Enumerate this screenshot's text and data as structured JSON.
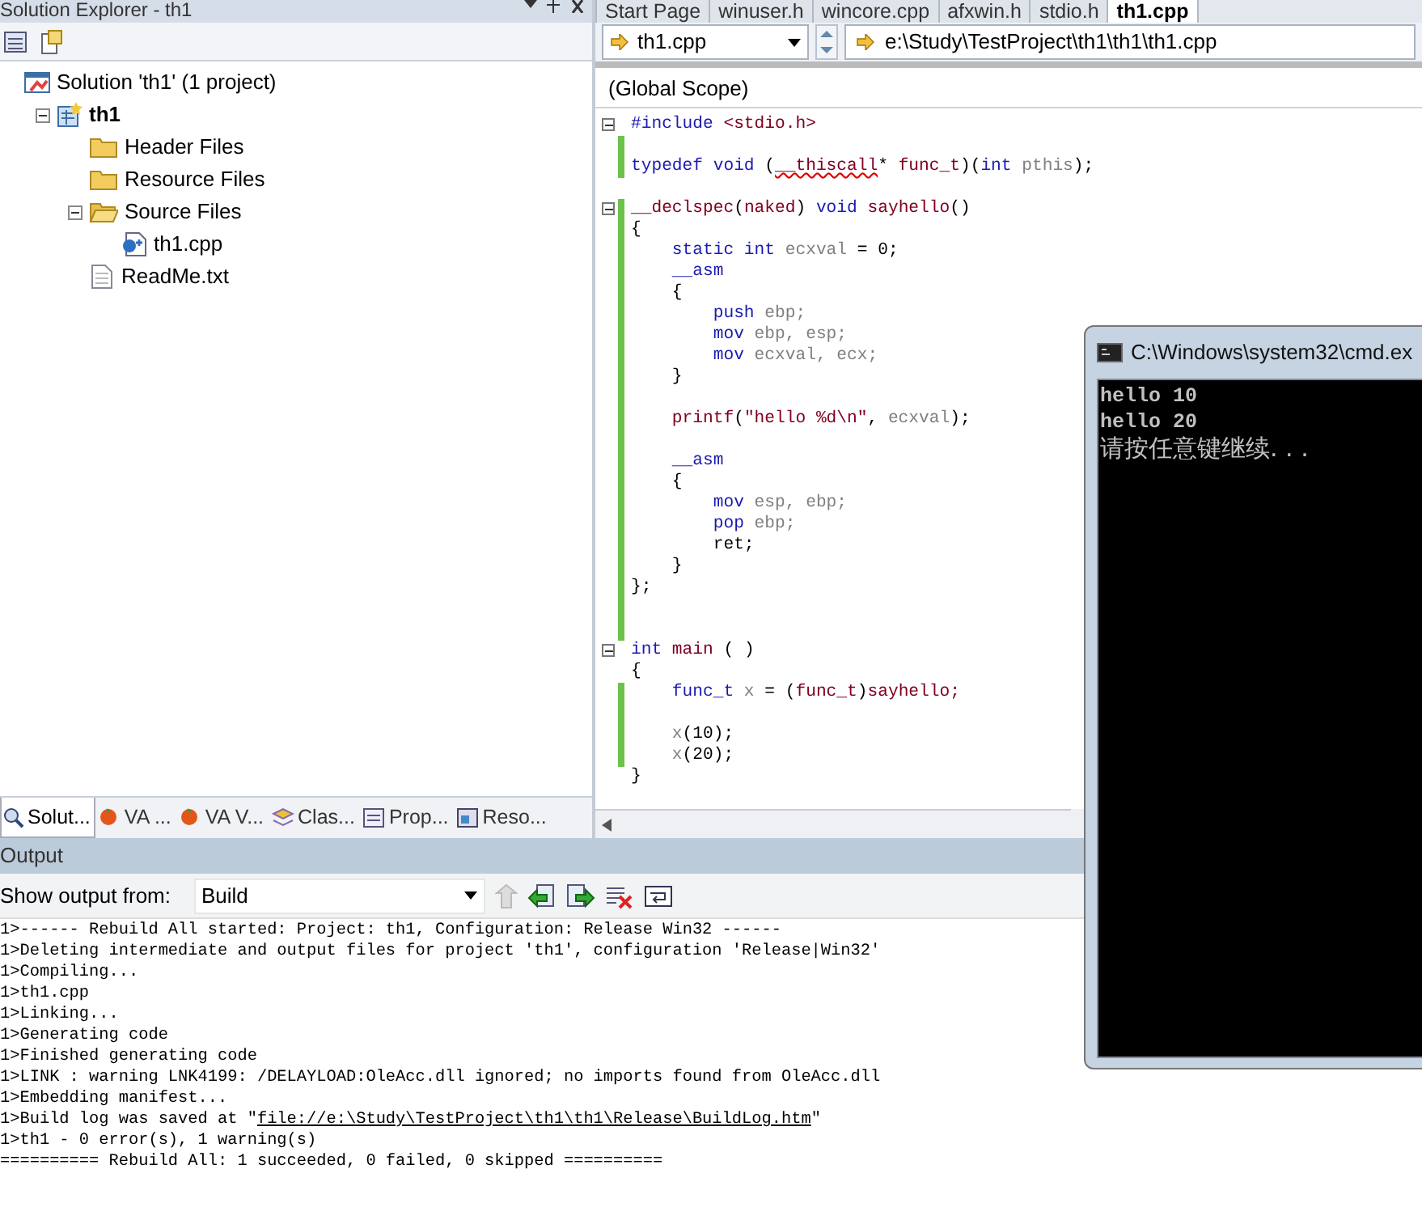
{
  "solution_explorer": {
    "title": "Solution Explorer - th1",
    "tree": [
      {
        "label": "Solution 'th1' (1 project)",
        "kind": "solution",
        "children": [
          {
            "label": "th1",
            "kind": "project",
            "expanded": true,
            "children": [
              {
                "label": "Header Files",
                "kind": "folder"
              },
              {
                "label": "Resource Files",
                "kind": "folder"
              },
              {
                "label": "Source Files",
                "kind": "folder-open",
                "expanded": true,
                "children": [
                  {
                    "label": "th1.cpp",
                    "kind": "cpp"
                  }
                ]
              },
              {
                "label": "ReadMe.txt",
                "kind": "text"
              }
            ]
          }
        ]
      }
    ],
    "tabs": [
      {
        "label": "Solut...",
        "selected": true
      },
      {
        "label": "VA ...",
        "selected": false
      },
      {
        "label": "VA V...",
        "selected": false
      },
      {
        "label": "Clas...",
        "selected": false
      },
      {
        "label": "Prop...",
        "selected": false
      },
      {
        "label": "Reso...",
        "selected": false
      }
    ]
  },
  "editor": {
    "tabs": [
      {
        "label": "Start Page",
        "selected": false
      },
      {
        "label": "winuser.h",
        "selected": false
      },
      {
        "label": "wincore.cpp",
        "selected": false
      },
      {
        "label": "afxwin.h",
        "selected": false
      },
      {
        "label": "stdio.h",
        "selected": false
      },
      {
        "label": "th1.cpp",
        "selected": true
      }
    ],
    "file_dropdown": "th1.cpp",
    "path": "e:\\Study\\TestProject\\th1\\th1\\th1.cpp",
    "scope": "(Global Scope)",
    "lines": [
      {
        "kind": "code",
        "fold": true,
        "changed": false,
        "tokens": [
          {
            "text": "#include",
            "kind": "kw"
          },
          {
            "text": " <stdio.h>",
            "kind": "fn"
          }
        ]
      },
      {
        "kind": "blank",
        "changed": true
      },
      {
        "kind": "code",
        "fold": false,
        "changed": true,
        "tokens": [
          {
            "text": "typedef void",
            "kind": "kw"
          },
          {
            "text": " (",
            "kind": "p"
          },
          {
            "text": "__thiscall",
            "kind": "err"
          },
          {
            "text": "* ",
            "kind": "p"
          },
          {
            "text": "func_t",
            "kind": "fn"
          },
          {
            "text": ")(",
            "kind": "p"
          },
          {
            "text": "int",
            "kind": "kw"
          },
          {
            "text": " pthis",
            "kind": "id"
          },
          {
            "text": ");",
            "kind": "p"
          }
        ]
      },
      {
        "kind": "blank",
        "changed": false
      },
      {
        "kind": "code",
        "fold": true,
        "changed": true,
        "tokens": [
          {
            "text": "__declspec",
            "kind": "fn"
          },
          {
            "text": "(",
            "kind": "p"
          },
          {
            "text": "naked",
            "kind": "fn"
          },
          {
            "text": ") ",
            "kind": "p"
          },
          {
            "text": "void",
            "kind": "kw"
          },
          {
            "text": " sayhello",
            "kind": "fn"
          },
          {
            "text": "()",
            "kind": "p"
          }
        ]
      },
      {
        "kind": "code",
        "fold": false,
        "changed": true,
        "tokens": [
          {
            "text": "{",
            "kind": "p"
          }
        ]
      },
      {
        "kind": "code",
        "fold": false,
        "changed": true,
        "tokens": [
          {
            "text": "    static int",
            "kind": "kw"
          },
          {
            "text": " ecxval",
            "kind": "id"
          },
          {
            "text": " = 0;",
            "kind": "p"
          }
        ]
      },
      {
        "kind": "code",
        "fold": false,
        "changed": true,
        "tokens": [
          {
            "text": "    __asm",
            "kind": "kw"
          }
        ]
      },
      {
        "kind": "code",
        "fold": false,
        "changed": true,
        "tokens": [
          {
            "text": "    {",
            "kind": "p"
          }
        ]
      },
      {
        "kind": "code",
        "fold": false,
        "changed": true,
        "tokens": [
          {
            "text": "        push",
            "kind": "kw"
          },
          {
            "text": " ebp;",
            "kind": "id"
          }
        ]
      },
      {
        "kind": "code",
        "fold": false,
        "changed": true,
        "tokens": [
          {
            "text": "        mov",
            "kind": "kw"
          },
          {
            "text": " ebp, esp;",
            "kind": "id"
          }
        ]
      },
      {
        "kind": "code",
        "fold": false,
        "changed": true,
        "tokens": [
          {
            "text": "        mov",
            "kind": "kw"
          },
          {
            "text": " ecxval, ecx;",
            "kind": "id"
          }
        ]
      },
      {
        "kind": "code",
        "fold": false,
        "changed": true,
        "tokens": [
          {
            "text": "    }",
            "kind": "p"
          }
        ]
      },
      {
        "kind": "blank",
        "changed": true
      },
      {
        "kind": "code",
        "fold": false,
        "changed": true,
        "tokens": [
          {
            "text": "    printf",
            "kind": "fn"
          },
          {
            "text": "(",
            "kind": "p"
          },
          {
            "text": "\"hello %d\\n\"",
            "kind": "fn"
          },
          {
            "text": ", ",
            "kind": "p"
          },
          {
            "text": "ecxval",
            "kind": "id"
          },
          {
            "text": ");",
            "kind": "p"
          }
        ]
      },
      {
        "kind": "blank",
        "changed": true
      },
      {
        "kind": "code",
        "fold": false,
        "changed": true,
        "tokens": [
          {
            "text": "    __asm",
            "kind": "kw"
          }
        ]
      },
      {
        "kind": "code",
        "fold": false,
        "changed": true,
        "tokens": [
          {
            "text": "    {",
            "kind": "p"
          }
        ]
      },
      {
        "kind": "code",
        "fold": false,
        "changed": true,
        "tokens": [
          {
            "text": "        mov",
            "kind": "kw"
          },
          {
            "text": " esp, ebp;",
            "kind": "id"
          }
        ]
      },
      {
        "kind": "code",
        "fold": false,
        "changed": true,
        "tokens": [
          {
            "text": "        pop",
            "kind": "kw"
          },
          {
            "text": " ebp;",
            "kind": "id"
          }
        ]
      },
      {
        "kind": "code",
        "fold": false,
        "changed": true,
        "tokens": [
          {
            "text": "        ret;",
            "kind": "p"
          }
        ]
      },
      {
        "kind": "code",
        "fold": false,
        "changed": true,
        "tokens": [
          {
            "text": "    }",
            "kind": "p"
          }
        ]
      },
      {
        "kind": "code",
        "fold": false,
        "changed": true,
        "tokens": [
          {
            "text": "};",
            "kind": "p"
          }
        ]
      },
      {
        "kind": "blank",
        "changed": true
      },
      {
        "kind": "blank",
        "changed": true
      },
      {
        "kind": "code",
        "fold": true,
        "changed": false,
        "tokens": [
          {
            "text": "int",
            "kind": "kw"
          },
          {
            "text": " main",
            "kind": "fn"
          },
          {
            "text": " ( )",
            "kind": "p"
          }
        ]
      },
      {
        "kind": "code",
        "fold": false,
        "changed": false,
        "tokens": [
          {
            "text": "{",
            "kind": "p"
          }
        ]
      },
      {
        "kind": "code",
        "fold": false,
        "changed": true,
        "tokens": [
          {
            "text": "    func_t",
            "kind": "kw"
          },
          {
            "text": " x",
            "kind": "id"
          },
          {
            "text": " = (",
            "kind": "p"
          },
          {
            "text": "func_t",
            "kind": "fn"
          },
          {
            "text": ")",
            "kind": "p"
          },
          {
            "text": "sayhello;",
            "kind": "fn"
          }
        ]
      },
      {
        "kind": "blank",
        "changed": true
      },
      {
        "kind": "code",
        "fold": false,
        "changed": true,
        "tokens": [
          {
            "text": "    x",
            "kind": "id"
          },
          {
            "text": "(10);",
            "kind": "p"
          }
        ]
      },
      {
        "kind": "code",
        "fold": false,
        "changed": true,
        "tokens": [
          {
            "text": "    x",
            "kind": "id"
          },
          {
            "text": "(20);",
            "kind": "p"
          }
        ]
      },
      {
        "kind": "code",
        "fold": false,
        "changed": false,
        "tokens": [
          {
            "text": "}",
            "kind": "p"
          }
        ]
      }
    ]
  },
  "output": {
    "title": "Output",
    "source_label": "Show output from:",
    "source": "Build",
    "lines": [
      [
        {
          "text": "1>------ Rebuild All started: Project: th1, Configuration: Release Win32 ------",
          "kind": "plain"
        }
      ],
      [
        {
          "text": "1>Deleting intermediate and output files for project 'th1', configuration 'Release|Win32'",
          "kind": "plain"
        }
      ],
      [
        {
          "text": "1>Compiling...",
          "kind": "plain"
        }
      ],
      [
        {
          "text": "1>th1.cpp",
          "kind": "plain"
        }
      ],
      [
        {
          "text": "1>Linking...",
          "kind": "plain"
        }
      ],
      [
        {
          "text": "1>Generating code",
          "kind": "plain"
        }
      ],
      [
        {
          "text": "1>Finished generating code",
          "kind": "plain"
        }
      ],
      [
        {
          "text": "1>LINK : warning LNK4199: /DELAYLOAD:OleAcc.dll ignored; no imports found from OleAcc.dll",
          "kind": "plain"
        }
      ],
      [
        {
          "text": "1>Embedding manifest...",
          "kind": "plain"
        }
      ],
      [
        {
          "text": "1>Build log was saved at \"",
          "kind": "plain"
        },
        {
          "text": "file://e:\\Study\\TestProject\\th1\\th1\\Release\\BuildLog.htm",
          "kind": "link"
        },
        {
          "text": "\"",
          "kind": "plain"
        }
      ],
      [
        {
          "text": "1>th1 - 0 error(s), 1 warning(s)",
          "kind": "plain"
        }
      ],
      [
        {
          "text": "========== Rebuild All: 1 succeeded, 0 failed, 0 skipped ==========",
          "kind": "plain"
        }
      ]
    ]
  },
  "console": {
    "title": "C:\\Windows\\system32\\cmd.ex",
    "lines": [
      "hello 10",
      "hello 20",
      "请按任意键继续. . ."
    ]
  }
}
